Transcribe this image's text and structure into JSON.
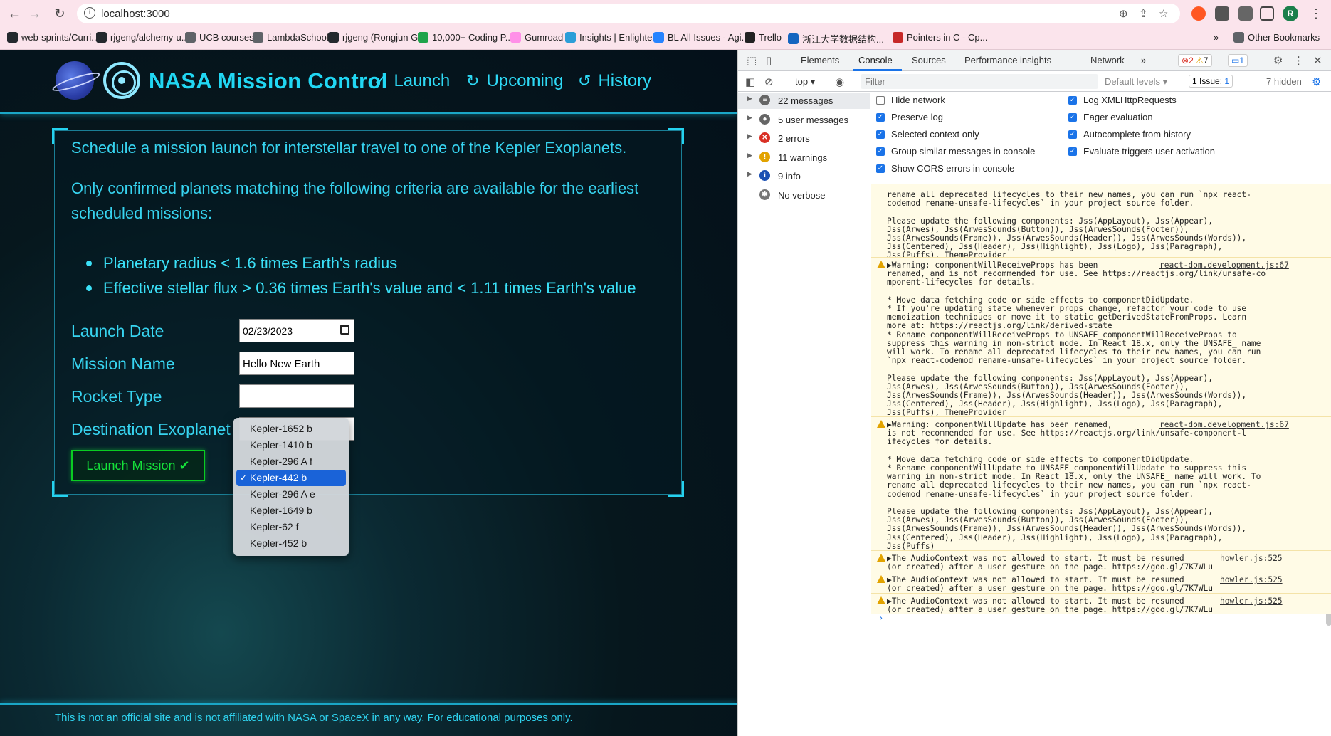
{
  "browser": {
    "url": "localhost:3000",
    "bookmarks": [
      {
        "label": "web-sprints/Curri...",
        "color": "#24292e"
      },
      {
        "label": "rjgeng/alchemy-u...",
        "color": "#24292e"
      },
      {
        "label": "UCB courses",
        "color": "#5f6368"
      },
      {
        "label": "LambdaSchool",
        "color": "#5f6368"
      },
      {
        "label": "rjgeng (Rongjun G...",
        "color": "#24292e"
      },
      {
        "label": "10,000+ Coding P...",
        "color": "#1fa34a"
      },
      {
        "label": "Gumroad",
        "color": "#ff90e8"
      },
      {
        "label": "Insights | Enlighte...",
        "color": "#2b9ed8"
      },
      {
        "label": "BL All Issues - Agi...",
        "color": "#2684ff"
      },
      {
        "label": "Trello",
        "color": "#222222"
      },
      {
        "label": "浙江大学数据结构...",
        "color": "#1565c0"
      },
      {
        "label": "Pointers in C - Cp...",
        "color": "#c62828"
      }
    ],
    "other_bookmarks": "Other Bookmarks",
    "avatar_letter": "R"
  },
  "app": {
    "title": "NASA Mission Control",
    "nav": [
      {
        "label": "Launch",
        "icon": "check-circle-icon"
      },
      {
        "label": "Upcoming",
        "icon": "refresh-icon"
      },
      {
        "label": "History",
        "icon": "history-icon"
      }
    ],
    "intro": "Schedule a mission launch for interstellar travel to one of the Kepler Exoplanets.",
    "criteria_intro": "Only confirmed planets matching the following criteria are available for the earliest scheduled missions:",
    "criteria": [
      "Planetary radius < 1.6 times Earth's radius",
      "Effective stellar flux > 0.36 times Earth's value and < 1.11 times Earth's value"
    ],
    "form": {
      "launch_date_label": "Launch Date",
      "launch_date_value": "02/23/2023",
      "mission_name_label": "Mission Name",
      "mission_name_value": "Hello New Earth",
      "rocket_type_label": "Rocket Type",
      "destination_label": "Destination Exoplanet",
      "destination_options": [
        "Kepler-1652 b",
        "Kepler-1410 b",
        "Kepler-296 A f",
        "Kepler-442 b",
        "Kepler-296 A e",
        "Kepler-1649 b",
        "Kepler-62 f",
        "Kepler-452 b"
      ],
      "selected_option": "Kepler-442 b",
      "submit_label": "Launch Mission ✔"
    },
    "footer": "This is not an official site and is not affiliated with NASA or SpaceX in any way. For educational purposes only.",
    "colors": {
      "accent": "#21d7f3",
      "button": "#15e23a"
    }
  },
  "devtools": {
    "tabs": [
      "Elements",
      "Console",
      "Sources",
      "Performance insights",
      "Network"
    ],
    "active_tab": "Console",
    "error_count": "2",
    "warning_count": "7",
    "info_count": "1",
    "context": "top",
    "filter_placeholder": "Filter",
    "levels": "Default levels",
    "issues": "1 Issue:",
    "issues_count": "1",
    "hidden": "7 hidden",
    "sidebar": [
      {
        "label": "22 messages",
        "icon": "list-icon"
      },
      {
        "label": "5 user messages",
        "icon": "user-icon"
      },
      {
        "label": "2 errors",
        "icon": "error-icon"
      },
      {
        "label": "11 warnings",
        "icon": "warning-icon"
      },
      {
        "label": "9 info",
        "icon": "info-icon"
      },
      {
        "label": "No verbose",
        "icon": "bug-icon"
      }
    ],
    "settings_left": [
      {
        "label": "Hide network",
        "checked": false
      },
      {
        "label": "Preserve log",
        "checked": true
      },
      {
        "label": "Selected context only",
        "checked": true
      },
      {
        "label": "Group similar messages in console",
        "checked": true
      },
      {
        "label": "Show CORS errors in console",
        "checked": true
      }
    ],
    "settings_right": [
      {
        "label": "Log XMLHttpRequests",
        "checked": true
      },
      {
        "label": "Eager evaluation",
        "checked": true
      },
      {
        "label": "Autocomplete from history",
        "checked": true
      },
      {
        "label": "Evaluate triggers user activation",
        "checked": true
      }
    ],
    "console_lines_1": [
      "rename all deprecated lifecycles to their new names, you can run `npx react-",
      "codemod rename-unsafe-lifecycles` in your project source folder.",
      "",
      "Please update the following components: Jss(AppLayout), Jss(Appear),",
      "Jss(Arwes), Jss(ArwesSounds(Button)), Jss(ArwesSounds(Footer)),",
      "Jss(ArwesSounds(Frame)), Jss(ArwesSounds(Header)), Jss(ArwesSounds(Words)),",
      "Jss(Centered), Jss(Header), Jss(Highlight), Jss(Logo), Jss(Paragraph),",
      "Jss(Puffs), ThemeProvider"
    ],
    "warn1": {
      "head": "▶Warning: componentWillReceiveProps has been",
      "src": "react-dom.development.js:67",
      "lines": [
        "renamed, and is not recommended for use. See https://reactjs.org/link/unsafe-co",
        "mponent-lifecycles for details.",
        "",
        "* Move data fetching code or side effects to componentDidUpdate.",
        "* If you're updating state whenever props change, refactor your code to use",
        "memoization techniques or move it to static getDerivedStateFromProps. Learn",
        "more at: https://reactjs.org/link/derived-state",
        "* Rename componentWillReceiveProps to UNSAFE_componentWillReceiveProps to",
        "suppress this warning in non-strict mode. In React 18.x, only the UNSAFE_ name",
        "will work. To rename all deprecated lifecycles to their new names, you can run",
        "`npx react-codemod rename-unsafe-lifecycles` in your project source folder.",
        "",
        "Please update the following components: Jss(AppLayout), Jss(Appear),",
        "Jss(Arwes), Jss(ArwesSounds(Button)), Jss(ArwesSounds(Footer)),",
        "Jss(ArwesSounds(Frame)), Jss(ArwesSounds(Header)), Jss(ArwesSounds(Words)),",
        "Jss(Centered), Jss(Header), Jss(Highlight), Jss(Logo), Jss(Paragraph),",
        "Jss(Puffs), ThemeProvider"
      ]
    },
    "warn2": {
      "head": "▶Warning: componentWillUpdate has been renamed,",
      "src": "react-dom.development.js:67",
      "lines": [
        "is not recommended for use. See https://reactjs.org/link/unsafe-component-l",
        "ifecycles for details.",
        "",
        "* Move data fetching code or side effects to componentDidUpdate.",
        "* Rename componentWillUpdate to UNSAFE_componentWillUpdate to suppress this",
        "warning in non-strict mode. In React 18.x, only the UNSAFE_ name will work. To",
        "rename all deprecated lifecycles to their new names, you can run `npx react-",
        "codemod rename-unsafe-lifecycles` in your project source folder.",
        "",
        "Please update the following components: Jss(AppLayout), Jss(Appear),",
        "Jss(Arwes), Jss(ArwesSounds(Button)), Jss(ArwesSounds(Footer)),",
        "Jss(ArwesSounds(Frame)), Jss(ArwesSounds(Header)), Jss(ArwesSounds(Words)),",
        "Jss(Centered), Jss(Header), Jss(Highlight), Jss(Logo), Jss(Paragraph),",
        "Jss(Puffs)"
      ]
    },
    "audio": {
      "head": "▶The AudioContext was not allowed to start. It must be resumed",
      "src": "howler.js:525",
      "line2": "(or created) after a user gesture on the page. https://goo.gl/7K7WLu"
    }
  }
}
